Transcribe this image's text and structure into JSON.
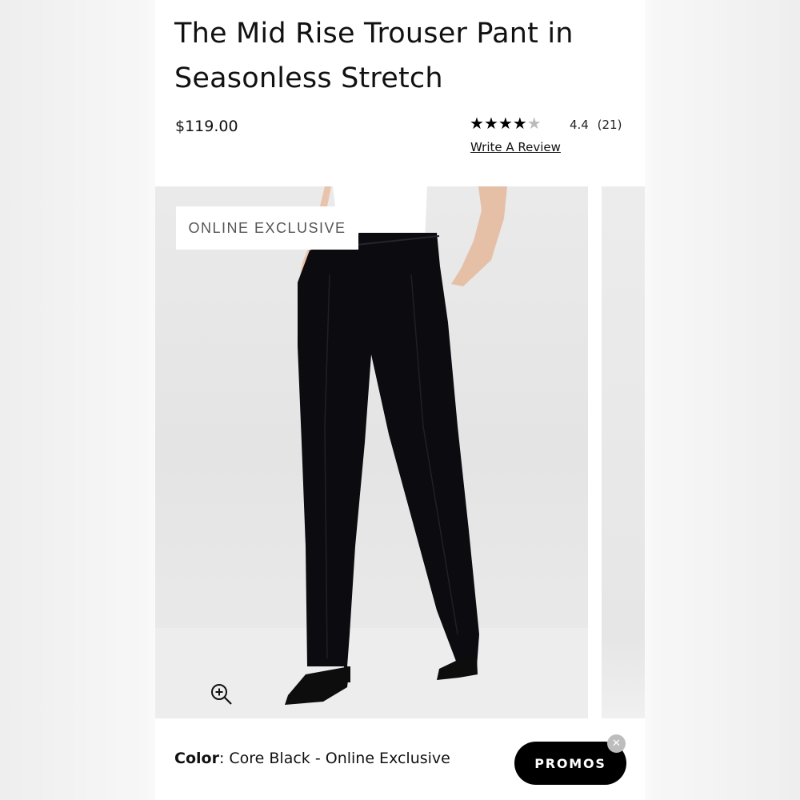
{
  "product": {
    "title": "The Mid Rise Trouser Pant in Seasonless Stretch",
    "price": "$119.00",
    "rating_stars": 4.4,
    "rating_text": "4.4",
    "review_count": "(21)",
    "write_review_label": "Write A Review"
  },
  "gallery": {
    "badge": "ONLINE EXCLUSIVE",
    "zoom_icon": "zoom-in-icon"
  },
  "color": {
    "label": "Color",
    "value": ": Core Black - Online Exclusive"
  },
  "promos": {
    "label": "PROMOS",
    "close_icon": "close-icon"
  }
}
